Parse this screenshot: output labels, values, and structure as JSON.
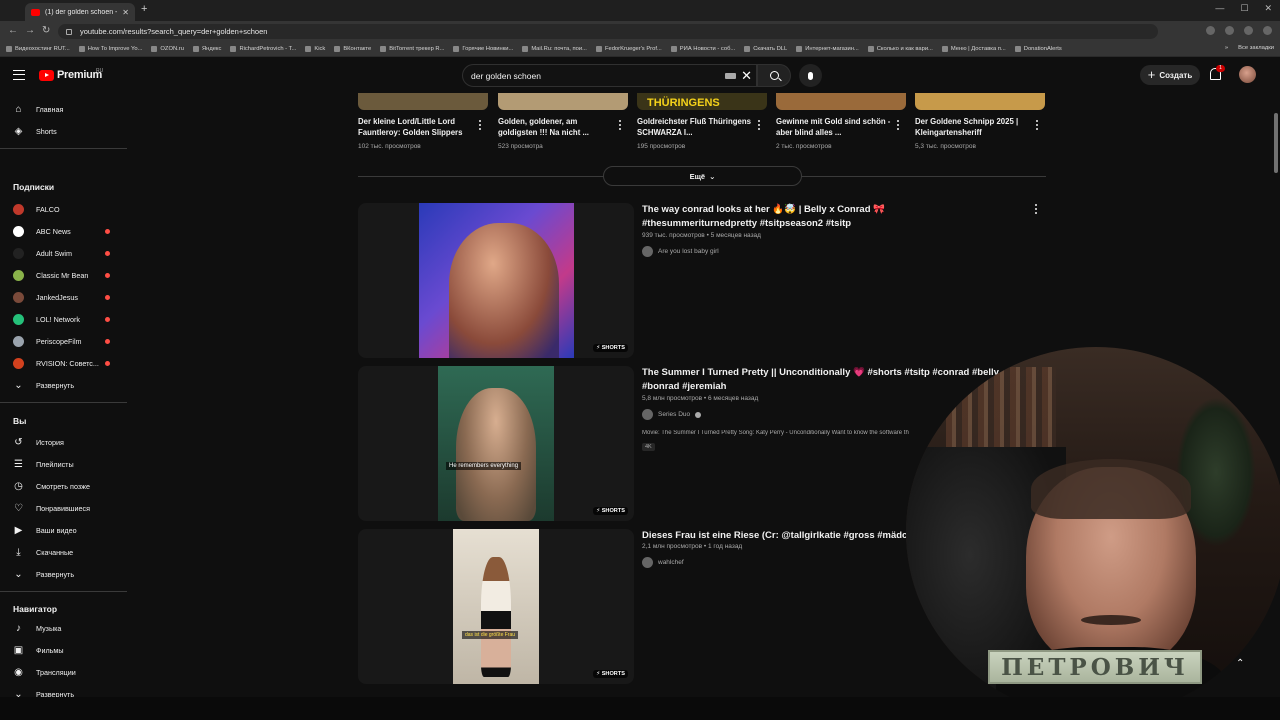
{
  "browser": {
    "tab_title": "(1) der golden schoen - YouTube",
    "url": "youtube.com/results?search_query=der+golden+schoen",
    "bookmarks": [
      "Видеохостинг RUT...",
      "How To Improve Yo...",
      "OZON.ru",
      "Яндекс",
      "RichardPetrovich - T...",
      "Kick",
      "ВКонтакте",
      "BitTorrent трекер R...",
      "Горячие Новинки...",
      "Mail.Ru: почта, пои...",
      "FedorKrueger's Prof...",
      "РИА Новости - соб...",
      "Скачать DLL",
      "Интернет-магазин...",
      "Сколько и как вари...",
      "Меню | Доставка п...",
      "DonationAlerts"
    ],
    "bookmarks_more": "»",
    "all_bookmarks": "Все закладки"
  },
  "header": {
    "logo_text": "Premium",
    "region": "RU",
    "search_value": "der golden schoen",
    "create_label": "Создать",
    "notification_count": "1"
  },
  "sidebar": {
    "main": [
      {
        "label": "Главная",
        "icon": "home-icon"
      },
      {
        "label": "Shorts",
        "icon": "shorts-icon"
      }
    ],
    "subscriptions_heading": "Подписки",
    "subscriptions": [
      {
        "label": "FALCO",
        "color": "#c0392b",
        "live": false
      },
      {
        "label": "ABC News",
        "color": "#ffffff",
        "live": true
      },
      {
        "label": "Adult Swim",
        "color": "#222222",
        "live": true
      },
      {
        "label": "Classic Mr Bean",
        "color": "#8ab24a",
        "live": true
      },
      {
        "label": "JankedJesus",
        "color": "#7a4a3a",
        "live": true
      },
      {
        "label": "LOL! Network",
        "color": "#25c17a",
        "live": true
      },
      {
        "label": "PeriscopeFilm",
        "color": "#9aa3ad",
        "live": true
      },
      {
        "label": "RVISION: Советс...",
        "color": "#d2411e",
        "live": true
      }
    ],
    "subs_expand": "Развернуть",
    "you_heading": "Вы",
    "you": [
      {
        "label": "История",
        "icon": "history-icon"
      },
      {
        "label": "Плейлисты",
        "icon": "playlists-icon"
      },
      {
        "label": "Смотреть позже",
        "icon": "watch-later-icon"
      },
      {
        "label": "Понравившиеся",
        "icon": "like-icon"
      },
      {
        "label": "Ваши видео",
        "icon": "your-videos-icon"
      },
      {
        "label": "Скачанные",
        "icon": "download-icon"
      }
    ],
    "you_expand": "Развернуть",
    "navigator_heading": "Навигатор",
    "navigator": [
      {
        "label": "Музыка",
        "icon": "music-icon"
      },
      {
        "label": "Фильмы",
        "icon": "films-icon"
      },
      {
        "label": "Трансляции",
        "icon": "live-icon"
      }
    ],
    "nav_expand": "Развернуть"
  },
  "top_row": [
    {
      "title": "Der kleine Lord/Little Lord Fauntleroy: Golden Slippers",
      "views": "102 тыс. просмотров",
      "thumb": "#6b5a3c"
    },
    {
      "title": "Golden, goldener, am goldigsten !!! Na nicht ...",
      "views": "523 просмотра",
      "thumb": "#b39b74"
    },
    {
      "title": "Goldreichster Fluß Thüringens SCHWARZA I...",
      "views": "195 просмотров",
      "thumb": "#3a3418",
      "thumb_text": "THÜRINGENS"
    },
    {
      "title": "Gewinne mit Gold sind schön - aber blind alles ...",
      "views": "2 тыс. просмотров",
      "thumb": "#9a6a3a"
    },
    {
      "title": "Der Goldene Schnipp 2025 | Kleingartensheriff",
      "views": "5,3 тыс. просмотров",
      "thumb": "#c79a4a"
    }
  ],
  "more_label": "Ещё",
  "results": [
    {
      "title": "The way conrad looks at her 🔥🤯 | Belly x Conrad 🎀 #thesummeriturnedpretty #tsitpseason2 #tsitp",
      "meta": "939 тыс. просмотров • 5 месяцев назад",
      "channel": "Are you lost baby girl",
      "verified": false,
      "desc": "",
      "badge": "",
      "shorts_label": "SHORTS",
      "thumb_color": "#2a3ab8",
      "thumb_accent": "#d1a24a"
    },
    {
      "title": "The Summer I Turned Pretty || Unconditionally 💗 #shorts #tsitp #conrad #belly #bonrad #jeremiah",
      "meta": "5,8 млн просмотров • 6 месяцев назад",
      "channel": "Series Duo",
      "verified": true,
      "desc": "Movie: The Summer I Turned Pretty Song: Katy Perry - Unconditionally Want to know the software th",
      "badge": "4K",
      "shorts_label": "SHORTS",
      "subtitle": "He remembers everything",
      "thumb_color": "#1f4a3a",
      "thumb_accent": "#c7a182"
    },
    {
      "title": "Dieses Frau ist eine Riese (Cr: @tallgirlkatie #gross #mädche",
      "meta": "2,1 млн просмотров • 1 год назад",
      "channel": "wahlchef",
      "verified": false,
      "desc": "",
      "badge": "",
      "shorts_label": "SHORTS",
      "subtitle": "das ist die größte Frau",
      "thumb_color": "#d9d2c4",
      "thumb_accent": "#1a1a1a"
    }
  ],
  "webcam": {
    "nameplate": "ПЕТРОВИЧ"
  }
}
